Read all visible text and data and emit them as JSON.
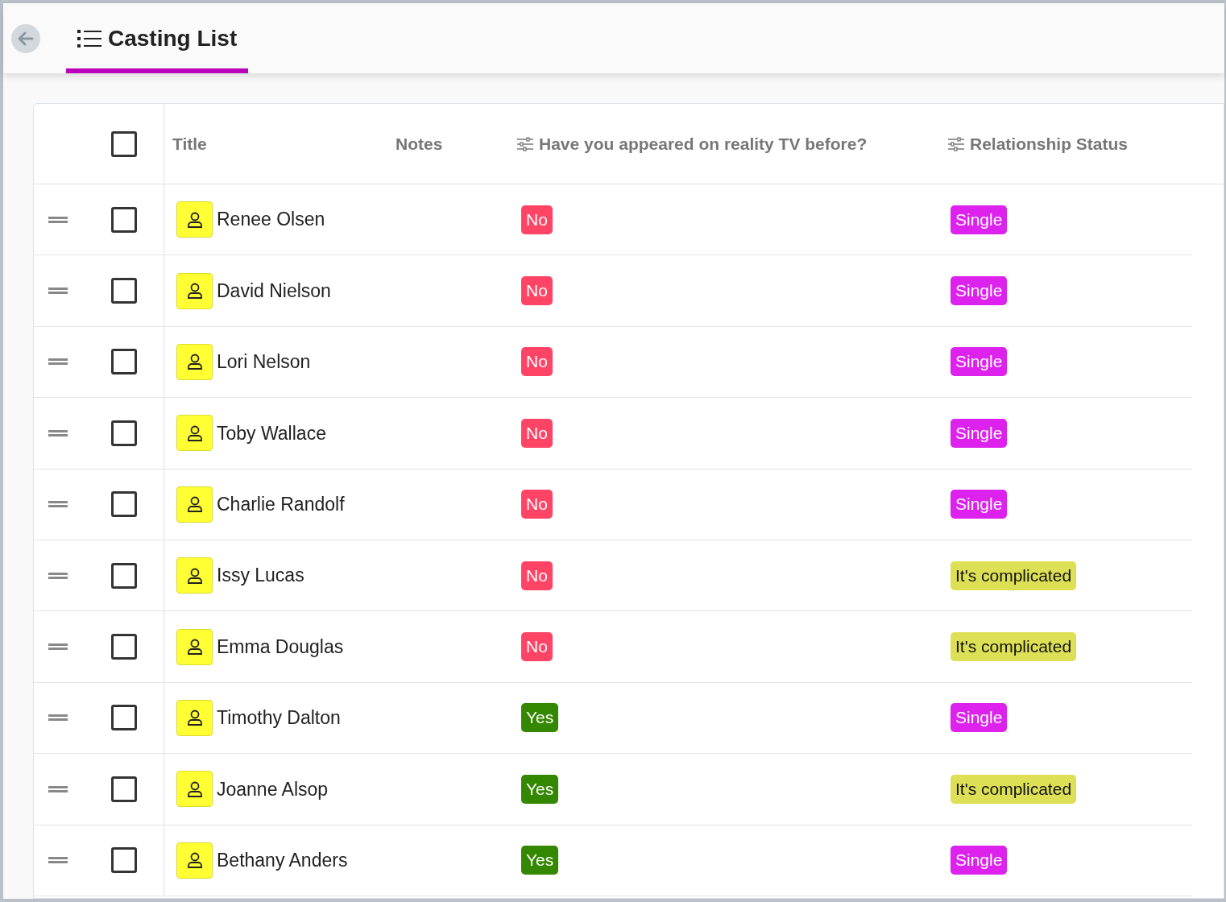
{
  "header": {
    "title": "Casting List",
    "tab_selected": true
  },
  "table": {
    "header_checkbox": {
      "checked": false
    },
    "columns": [
      {
        "label": "Title",
        "kind": "plain"
      },
      {
        "label": "Notes",
        "kind": "plain"
      },
      {
        "label": "Have you appeared on reality TV before?",
        "kind": "select"
      },
      {
        "label": "Relationship Status",
        "kind": "select"
      }
    ],
    "rows": [
      {
        "checked": false,
        "title": "Renee Olsen",
        "tv": {
          "label": "No",
          "color": "#ff4466"
        },
        "status": {
          "label": "Single",
          "color": "#dd22ee"
        }
      },
      {
        "checked": false,
        "title": "David Nielson",
        "tv": {
          "label": "No",
          "color": "#ff4466"
        },
        "status": {
          "label": "Single",
          "color": "#dd22ee"
        }
      },
      {
        "checked": false,
        "title": "Lori Nelson",
        "tv": {
          "label": "No",
          "color": "#ff4466"
        },
        "status": {
          "label": "Single",
          "color": "#dd22ee"
        }
      },
      {
        "checked": false,
        "title": "Toby Wallace",
        "tv": {
          "label": "No",
          "color": "#ff4466"
        },
        "status": {
          "label": "Single",
          "color": "#dd22ee"
        }
      },
      {
        "checked": false,
        "title": "Charlie Randolf",
        "tv": {
          "label": "No",
          "color": "#ff4466"
        },
        "status": {
          "label": "Single",
          "color": "#dd22ee"
        }
      },
      {
        "checked": false,
        "title": "Issy Lucas",
        "tv": {
          "label": "No",
          "color": "#ff4466"
        },
        "status": {
          "label": "It's complicated",
          "color": "#dde055"
        }
      },
      {
        "checked": false,
        "title": "Emma Douglas",
        "tv": {
          "label": "No",
          "color": "#ff4466"
        },
        "status": {
          "label": "It's complicated",
          "color": "#dde055"
        }
      },
      {
        "checked": false,
        "title": "Timothy Dalton",
        "tv": {
          "label": "Yes",
          "color": "#338800"
        },
        "status": {
          "label": "Single",
          "color": "#dd22ee"
        }
      },
      {
        "checked": false,
        "title": "Joanne Alsop",
        "tv": {
          "label": "Yes",
          "color": "#338800"
        },
        "status": {
          "label": "It's complicated",
          "color": "#dde055"
        }
      },
      {
        "checked": false,
        "title": "Bethany Anders",
        "tv": {
          "label": "Yes",
          "color": "#338800"
        },
        "status": {
          "label": "Single",
          "color": "#dd22ee"
        }
      }
    ]
  }
}
